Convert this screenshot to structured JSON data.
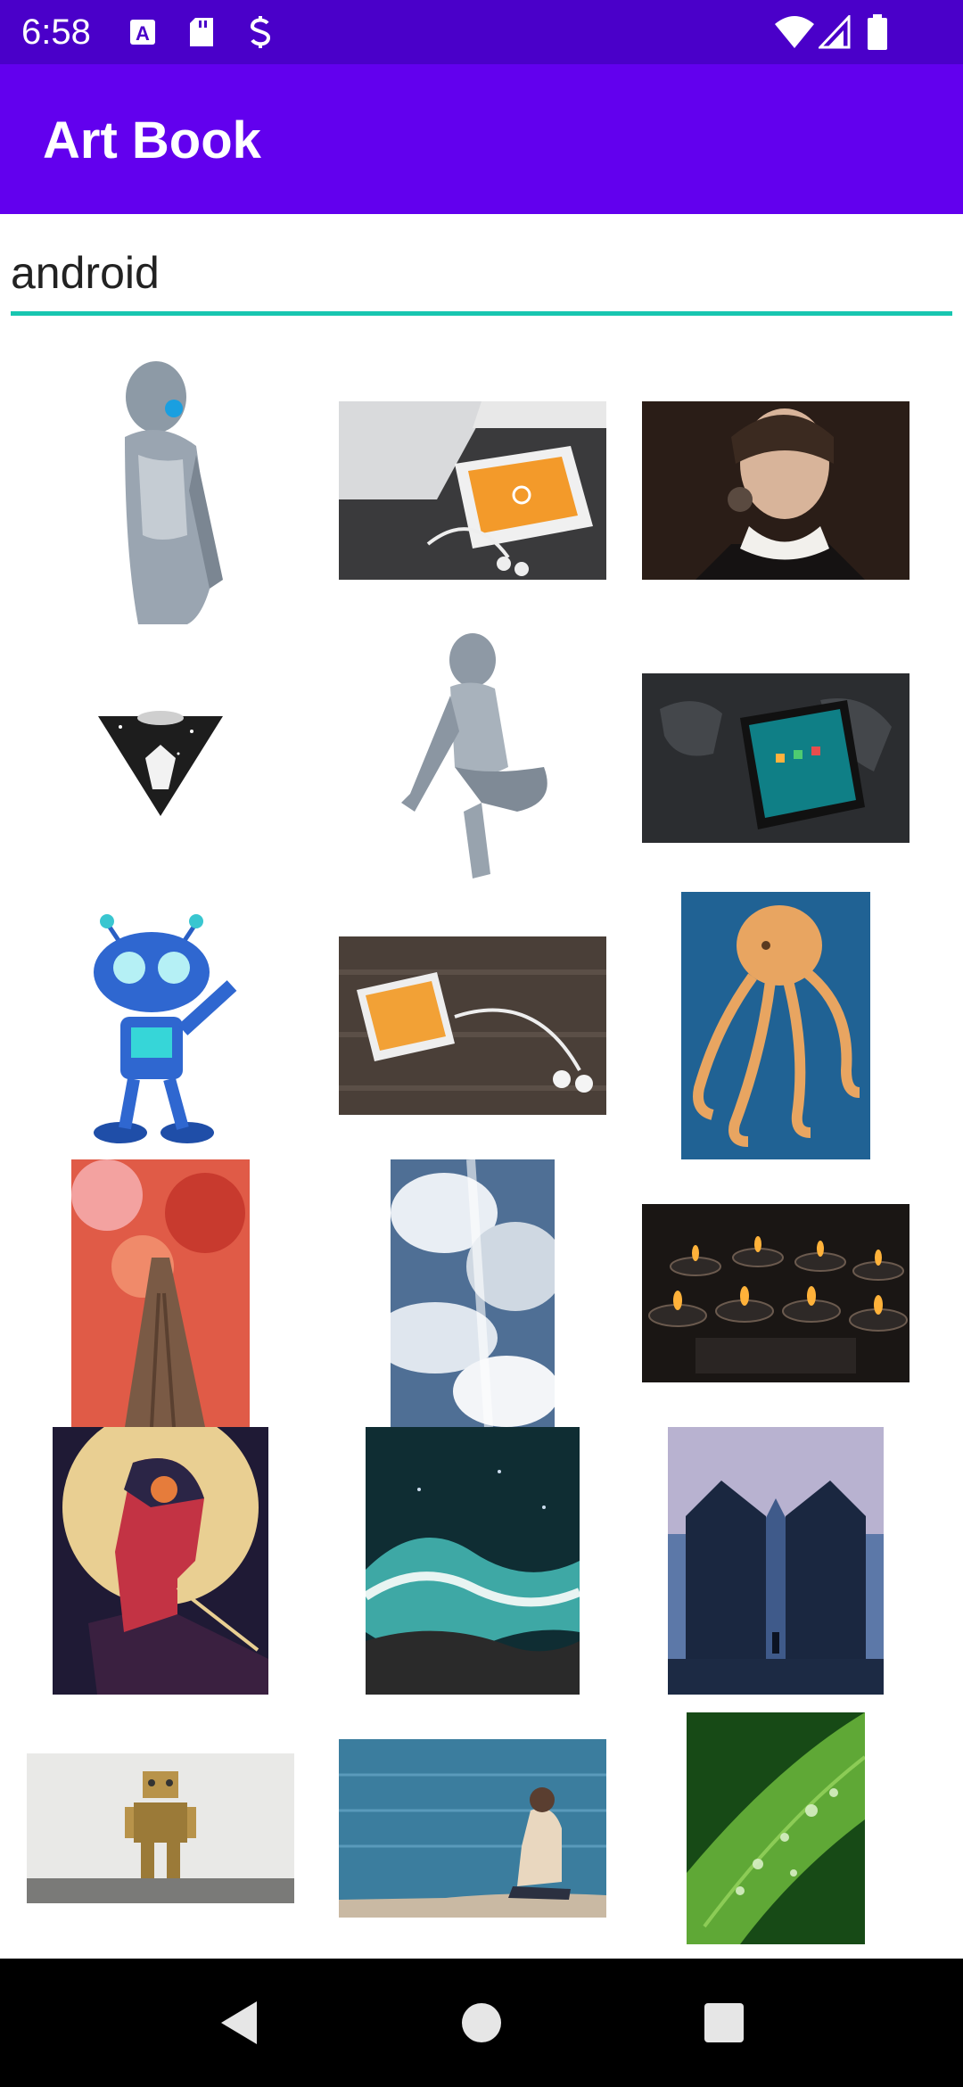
{
  "status_bar": {
    "time": "6:58",
    "left_icons": [
      "font-a-icon",
      "sd-card-icon",
      "sync-s-icon"
    ],
    "right_icons": [
      "wifi-icon",
      "signal-icon",
      "battery-icon"
    ]
  },
  "app_bar": {
    "title": "Art Book"
  },
  "search": {
    "value": "android",
    "accent_color": "#18c6b0"
  },
  "colors": {
    "status_bar": "#4a00c9",
    "app_bar": "#6200ee"
  },
  "images": [
    {
      "name": "humanoid-robot-image"
    },
    {
      "name": "phone-keyboard-earbuds-image"
    },
    {
      "name": "cyborg-woman-image"
    },
    {
      "name": "triangle-ufo-art-image"
    },
    {
      "name": "crouching-robot-woman-image"
    },
    {
      "name": "smartphone-world-map-image"
    },
    {
      "name": "blue-cartoon-alien-robot-image"
    },
    {
      "name": "phone-earphones-table-image"
    },
    {
      "name": "octopus-illustration-image"
    },
    {
      "name": "red-autumn-tree-image"
    },
    {
      "name": "cloudy-sky-image"
    },
    {
      "name": "tea-candles-image"
    },
    {
      "name": "robot-profile-poster-image"
    },
    {
      "name": "ocean-waves-aerial-image"
    },
    {
      "name": "bali-gate-mountain-image"
    },
    {
      "name": "toy-robot-image"
    },
    {
      "name": "man-sitting-by-sea-image"
    },
    {
      "name": "leaf-water-drops-image"
    }
  ],
  "navigation": [
    "back-icon",
    "home-icon",
    "recents-icon"
  ]
}
